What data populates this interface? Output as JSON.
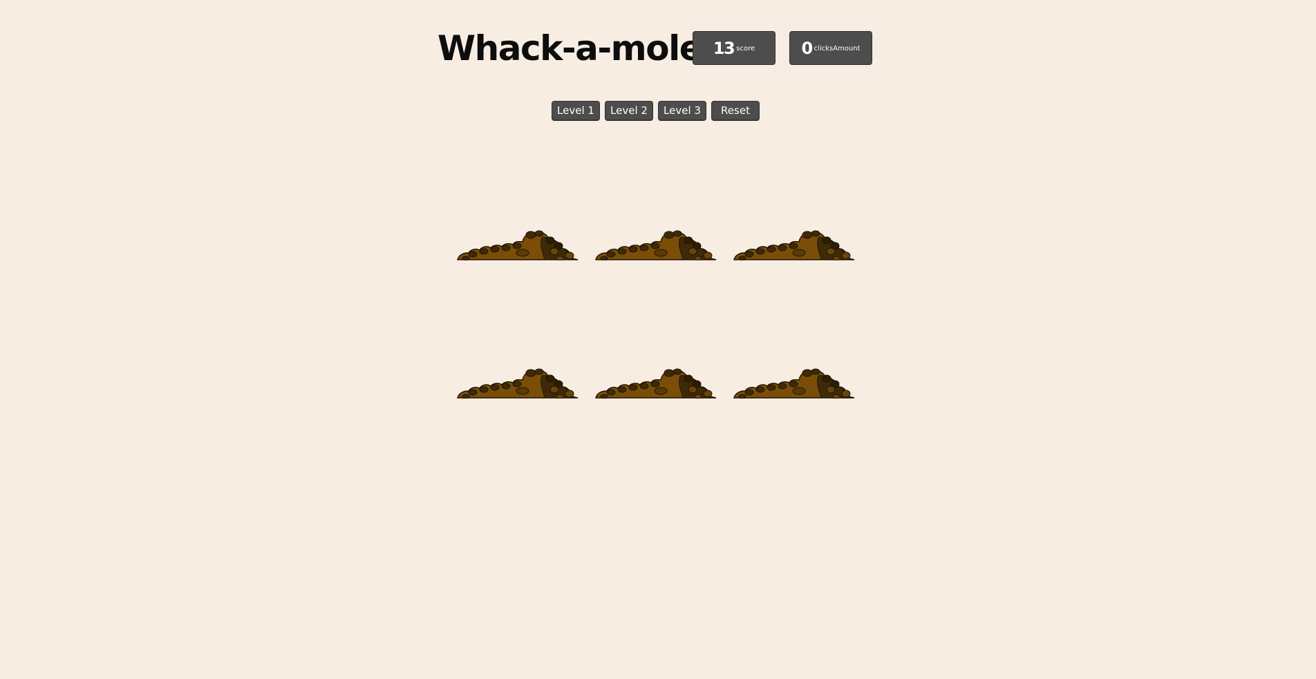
{
  "game": {
    "title": "Whack-a-mole",
    "score": {
      "value": "13",
      "label": "score"
    },
    "clicks": {
      "value": "0",
      "label": "clicksAmount"
    }
  },
  "controls": {
    "level1_label": "Level 1",
    "level2_label": "Level 2",
    "level3_label": "Level 3",
    "reset_label": "Reset"
  },
  "board": {
    "rows": 2,
    "columns": 3,
    "holes": [
      {
        "id": 1,
        "mole_visible": false
      },
      {
        "id": 2,
        "mole_visible": false
      },
      {
        "id": 3,
        "mole_visible": false
      },
      {
        "id": 4,
        "mole_visible": false
      },
      {
        "id": 5,
        "mole_visible": false
      },
      {
        "id": 6,
        "mole_visible": false
      }
    ]
  },
  "colors": {
    "background": "#f8ede2",
    "button": "#4d4d4d",
    "dirt_light": "#7a4e07",
    "dirt_dark": "#3f2a08",
    "dirt_outline": "#1f1405"
  },
  "icons": {
    "hole": "dirt-mound-icon"
  }
}
